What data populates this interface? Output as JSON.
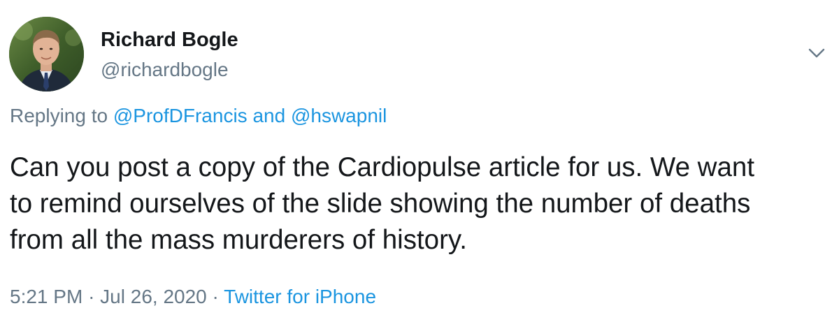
{
  "author": {
    "display_name": "Richard Bogle",
    "handle": "@richardbogle",
    "avatar_icon": "profile-photo"
  },
  "reply": {
    "prefix": "Replying to",
    "mention_1": "@ProfDFrancis",
    "joiner": "and",
    "mention_2": "@hswapnil"
  },
  "tweet": {
    "lines": [
      "Can you post a copy of the Cardiopulse article for us. We want",
      "to remind ourselves of the slide showing the number of deaths",
      "from all the mass murderers of history."
    ]
  },
  "meta": {
    "time": "5:21 PM",
    "separator": "·",
    "date": "Jul 26, 2020",
    "source": "Twitter for iPhone"
  },
  "colors": {
    "text_primary": "#14171a",
    "text_secondary": "#657786",
    "link": "#1b95e0"
  },
  "icons": {
    "caret": "chevron-down-icon"
  }
}
